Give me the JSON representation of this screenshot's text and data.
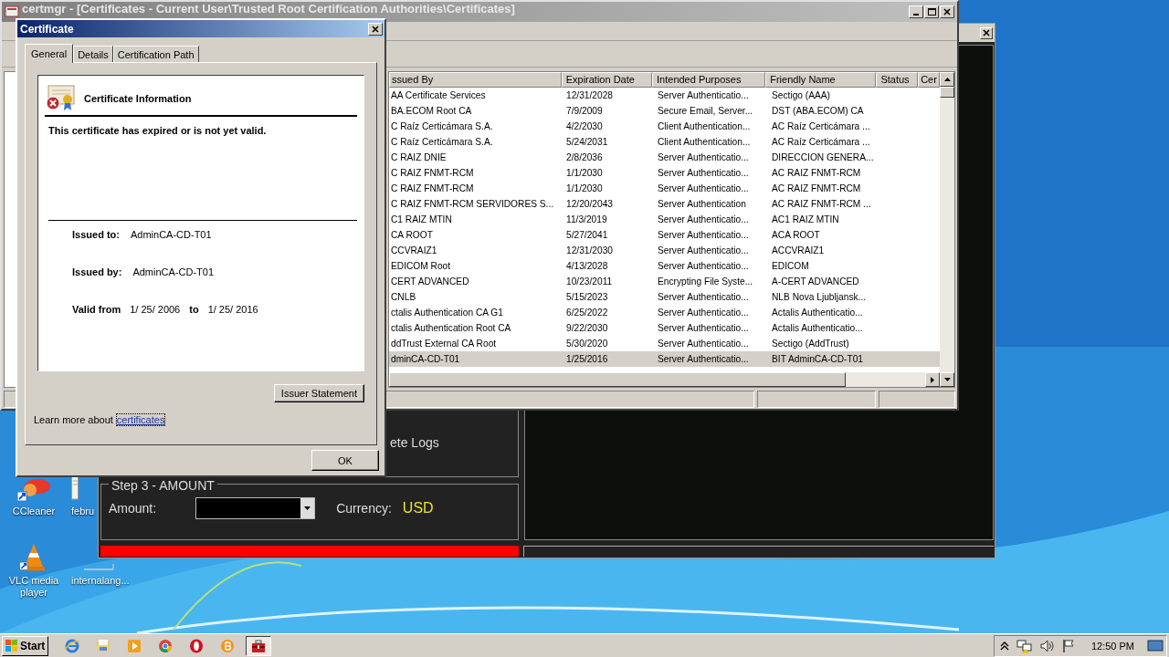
{
  "background_app": {
    "logs_button": "ete Logs",
    "amount_group": {
      "title": "Step 3 - AMOUNT",
      "amount_label": "Amount:",
      "currency_label": "Currency:",
      "currency": "USD"
    }
  },
  "certmgr": {
    "title": "certmgr - [Certificates - Current User\\Trusted Root Certification Authorities\\Certificates]",
    "columns": [
      "ssued By",
      "Expiration Date",
      "Intended Purposes",
      "Friendly Name",
      "Status",
      "Cer"
    ],
    "rows": [
      {
        "issued_by": "AA Certificate Services",
        "expiration": "12/31/2028",
        "purposes": "Server Authenticatio...",
        "friendly": "Sectigo (AAA)",
        "selected": false
      },
      {
        "issued_by": "BA.ECOM Root CA",
        "expiration": "7/9/2009",
        "purposes": "Secure Email, Server...",
        "friendly": "DST (ABA.ECOM) CA",
        "selected": false
      },
      {
        "issued_by": "C Raíz Certicámara S.A.",
        "expiration": "4/2/2030",
        "purposes": "Client Authentication...",
        "friendly": "AC Raíz Certicámara ...",
        "selected": false
      },
      {
        "issued_by": "C Raíz Certicámara S.A.",
        "expiration": "5/24/2031",
        "purposes": "Client Authentication...",
        "friendly": "AC Raíz Certicámara ...",
        "selected": false
      },
      {
        "issued_by": "C RAIZ DNIE",
        "expiration": "2/8/2036",
        "purposes": "Server Authenticatio...",
        "friendly": "DIRECCION GENERA...",
        "selected": false
      },
      {
        "issued_by": "C RAIZ FNMT-RCM",
        "expiration": "1/1/2030",
        "purposes": "Server Authenticatio...",
        "friendly": "AC RAIZ FNMT-RCM",
        "selected": false
      },
      {
        "issued_by": "C RAIZ FNMT-RCM",
        "expiration": "1/1/2030",
        "purposes": "Server Authenticatio...",
        "friendly": "AC RAIZ FNMT-RCM",
        "selected": false
      },
      {
        "issued_by": "C RAIZ FNMT-RCM SERVIDORES S...",
        "expiration": "12/20/2043",
        "purposes": "Server Authentication",
        "friendly": "AC RAIZ FNMT-RCM ...",
        "selected": false
      },
      {
        "issued_by": "C1 RAIZ MTIN",
        "expiration": "11/3/2019",
        "purposes": "Server Authenticatio...",
        "friendly": "AC1 RAIZ MTIN",
        "selected": false
      },
      {
        "issued_by": "CA ROOT",
        "expiration": "5/27/2041",
        "purposes": "Server Authenticatio...",
        "friendly": "ACA ROOT",
        "selected": false
      },
      {
        "issued_by": "CCVRAIZ1",
        "expiration": "12/31/2030",
        "purposes": "Server Authenticatio...",
        "friendly": "ACCVRAIZ1",
        "selected": false
      },
      {
        "issued_by": "EDICOM Root",
        "expiration": "4/13/2028",
        "purposes": "Server Authenticatio...",
        "friendly": "EDICOM",
        "selected": false
      },
      {
        "issued_by": "CERT ADVANCED",
        "expiration": "10/23/2011",
        "purposes": "Encrypting File Syste...",
        "friendly": "A-CERT ADVANCED",
        "selected": false
      },
      {
        "issued_by": "CNLB",
        "expiration": "5/15/2023",
        "purposes": "Server Authenticatio...",
        "friendly": "NLB Nova Ljubljansk...",
        "selected": false
      },
      {
        "issued_by": "ctalis Authentication CA G1",
        "expiration": "6/25/2022",
        "purposes": "Server Authenticatio...",
        "friendly": "Actalis Authenticatio...",
        "selected": false
      },
      {
        "issued_by": "ctalis Authentication Root CA",
        "expiration": "9/22/2030",
        "purposes": "Server Authenticatio...",
        "friendly": "Actalis Authenticatio...",
        "selected": false
      },
      {
        "issued_by": "ddTrust External CA Root",
        "expiration": "5/30/2020",
        "purposes": "Server Authenticatio...",
        "friendly": "Sectigo (AddTrust)",
        "selected": false
      },
      {
        "issued_by": "dminCA-CD-T01",
        "expiration": "1/25/2016",
        "purposes": "Server Authenticatio...",
        "friendly": "BIT AdminCA-CD-T01",
        "selected": true
      }
    ]
  },
  "dialog": {
    "title": "Certificate",
    "tabs": [
      {
        "label": "General",
        "selected": true
      },
      {
        "label": "Details",
        "selected": false
      },
      {
        "label": "Certification Path",
        "selected": false
      }
    ],
    "heading": "Certificate Information",
    "message": "This certificate has expired or is not yet valid.",
    "fields": [
      {
        "label": "Issued to:",
        "value": "AdminCA-CD-T01"
      },
      {
        "label": "Issued by:",
        "value": "AdminCA-CD-T01"
      }
    ],
    "validity": {
      "label": "Valid from",
      "from": "1/ 25/ 2006",
      "to_label": "to",
      "to": "1/ 25/ 2016"
    },
    "issuer_button": "Issuer Statement",
    "learn_more": {
      "text": "Learn more about",
      "link": "certificates"
    },
    "ok_button": "OK"
  },
  "desktop_icons": [
    {
      "kind": "ccleaner",
      "label": "CCleaner"
    },
    {
      "kind": "file",
      "label": "febru"
    },
    {
      "kind": "vlc",
      "label": "VLC media player"
    },
    {
      "kind": "blank",
      "label": "internalang..."
    }
  ],
  "taskbar": {
    "start": "Start",
    "apps": [
      {
        "kind": "ie",
        "selected": false
      },
      {
        "kind": "folder",
        "selected": false
      },
      {
        "kind": "media",
        "selected": false
      },
      {
        "kind": "chrome",
        "selected": false
      },
      {
        "kind": "opera",
        "selected": false
      },
      {
        "kind": "bitcoin",
        "selected": false
      },
      {
        "kind": "toolbox",
        "selected": true
      }
    ],
    "clock": "12:50 PM"
  }
}
